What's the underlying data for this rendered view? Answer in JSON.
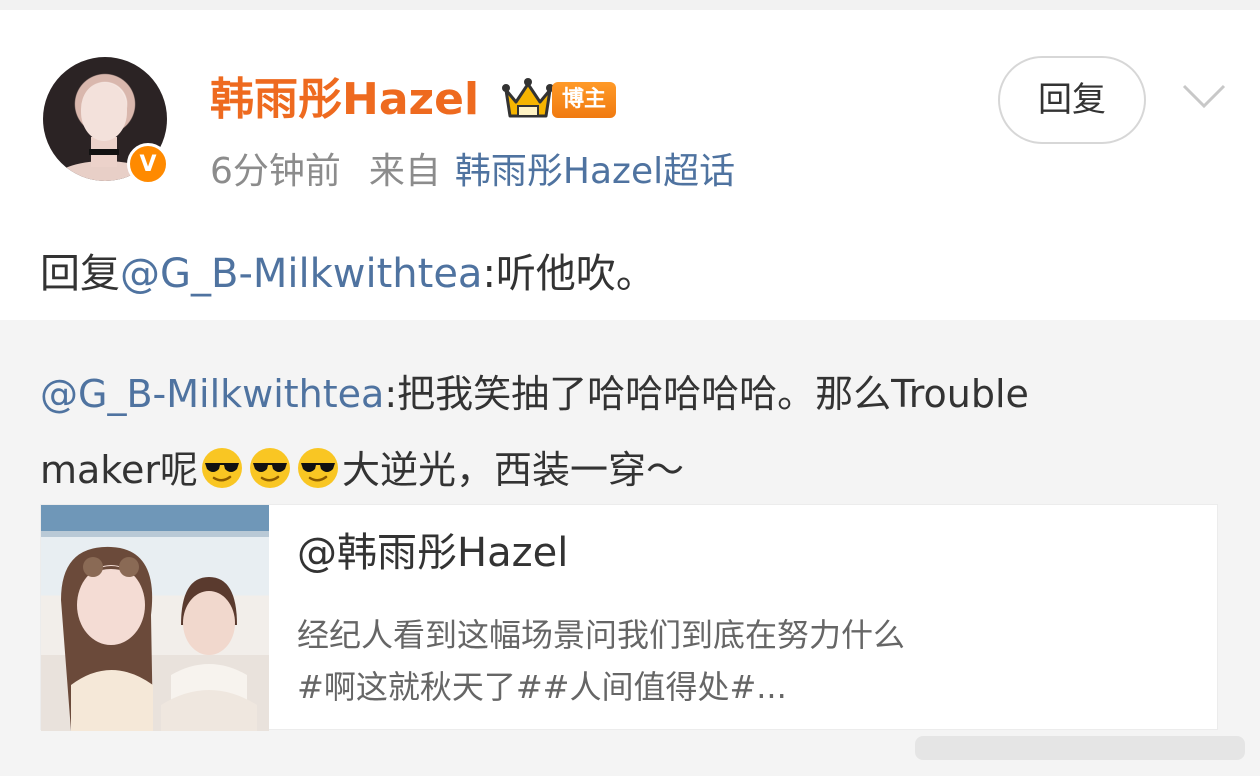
{
  "post": {
    "author_name": "韩雨彤Hazel",
    "author_badge": "博主",
    "verified_mark": "V",
    "time_ago": "6分钟前",
    "from_label": "来自",
    "source_topic": "韩雨彤Hazel超话",
    "reply_button_label": "回复",
    "reply_prefix": "回复",
    "reply_mention": "@G_B-Milkwithtea",
    "reply_text": ":听他吹。"
  },
  "quote": {
    "mention": "@G_B-Milkwithtea",
    "text_line1": ":把我笑抽了哈哈哈哈哈。那么Trouble",
    "text_line2_a": "maker呢",
    "emoji": "sunglasses-face-icon",
    "text_line2_b": "大逆光，西装一穿～",
    "card": {
      "title": "@韩雨彤Hazel",
      "desc_line1": "经纪人看到这幅场景问我们到底在努力什么",
      "desc_line2": "#啊这就秋天了##人间值得处#..."
    }
  },
  "icons": {
    "crown": "crown-icon",
    "more": "chevron-down-icon"
  },
  "colors": {
    "author": "#ee6a1f",
    "link": "#4f73a0",
    "badge": "#f07a10",
    "muted": "#8c8c8c"
  }
}
